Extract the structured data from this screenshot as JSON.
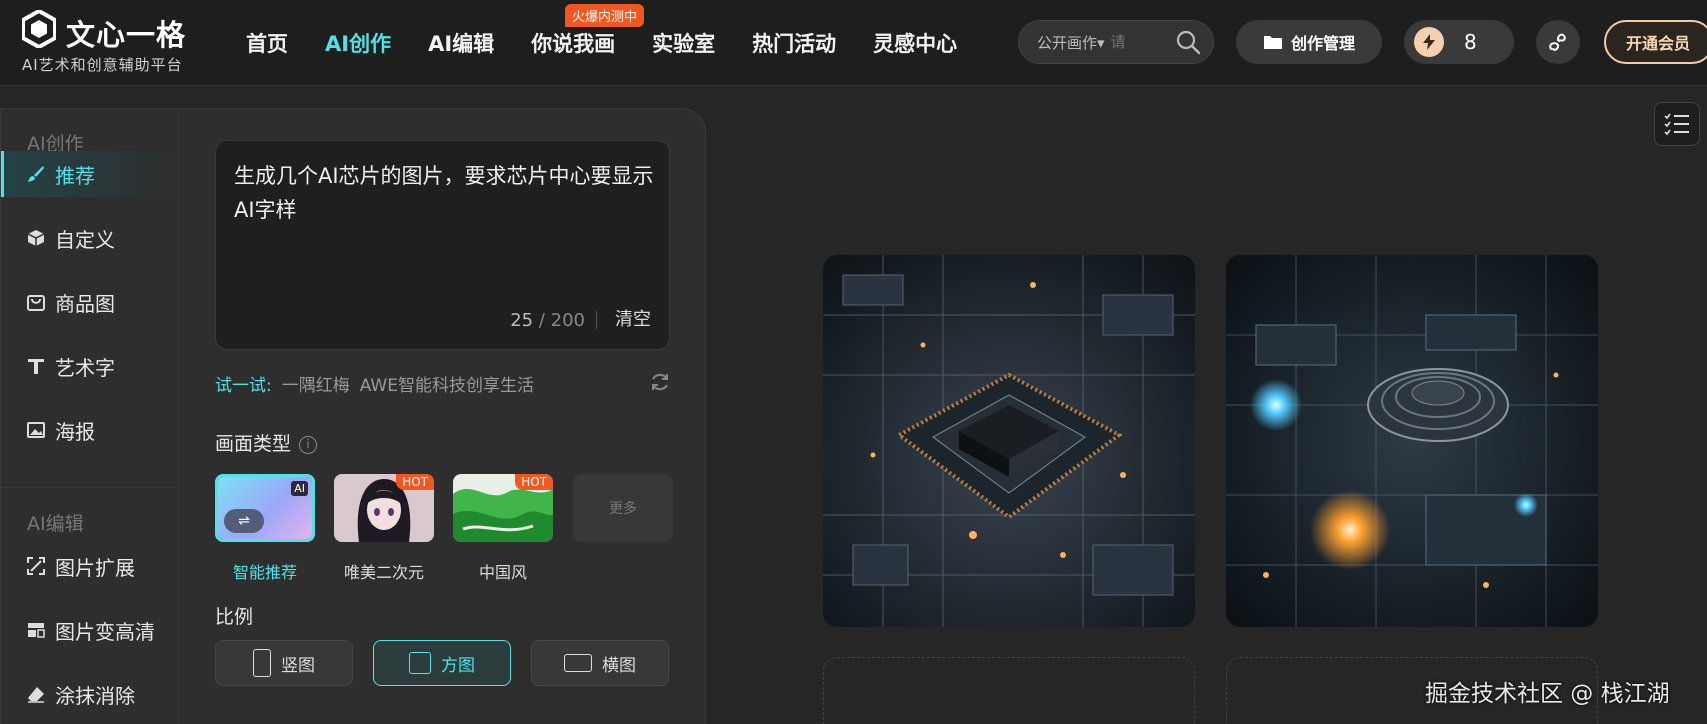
{
  "brand": {
    "title": "文心一格",
    "subtitle": "AI艺术和创意辅助平台"
  },
  "nav": {
    "items": [
      {
        "label": "首页"
      },
      {
        "label": "AI创作"
      },
      {
        "label": "AI编辑"
      },
      {
        "label": "你说我画"
      },
      {
        "label": "实验室"
      },
      {
        "label": "热门活动"
      },
      {
        "label": "灵感中心"
      }
    ],
    "active_index": 1,
    "badge": "火爆内测中"
  },
  "search": {
    "scope": "公开画作▾",
    "placeholder": "请"
  },
  "header_actions": {
    "manage_label": "创作管理",
    "points": "8",
    "vip_label": "开通会员"
  },
  "sidebar": {
    "group1": "AI创作",
    "group2": "AI编辑",
    "items": [
      {
        "label": "推荐",
        "icon": "brush-icon"
      },
      {
        "label": "自定义",
        "icon": "cube-icon"
      },
      {
        "label": "商品图",
        "icon": "bag-icon"
      },
      {
        "label": "艺术字",
        "icon": "art-text-icon"
      },
      {
        "label": "海报",
        "icon": "image-icon"
      },
      {
        "label": "图片扩展",
        "icon": "expand-icon"
      },
      {
        "label": "图片变高清",
        "icon": "hd-icon"
      },
      {
        "label": "涂抹消除",
        "icon": "eraser-icon"
      }
    ]
  },
  "prompt": {
    "text": "生成几个AI芯片的图片，要求芯片中心要显示AI字样",
    "count": "25",
    "max": " / 200",
    "clear_label": "清空"
  },
  "try_it": {
    "label": "试一试:",
    "items": [
      "一隅红梅",
      "AWE智能科技创享生活"
    ]
  },
  "style_section": {
    "title": "画面类型",
    "cards": [
      {
        "label": "智能推荐",
        "badge": ""
      },
      {
        "label": "唯美二次元",
        "badge": "HOT"
      },
      {
        "label": "中国风",
        "badge": "HOT"
      }
    ],
    "more_label": "更多",
    "ai_badge": "AI"
  },
  "ratio_section": {
    "title": "比例",
    "options": [
      {
        "label": "竖图"
      },
      {
        "label": "方图"
      },
      {
        "label": "横图"
      }
    ],
    "selected": "方图"
  },
  "watermark": "掘金技术社区 @ 栈江湖",
  "colors": {
    "accent": "#4fe3e6",
    "hot": "#f2571f",
    "vip": "#f0cfa8"
  }
}
